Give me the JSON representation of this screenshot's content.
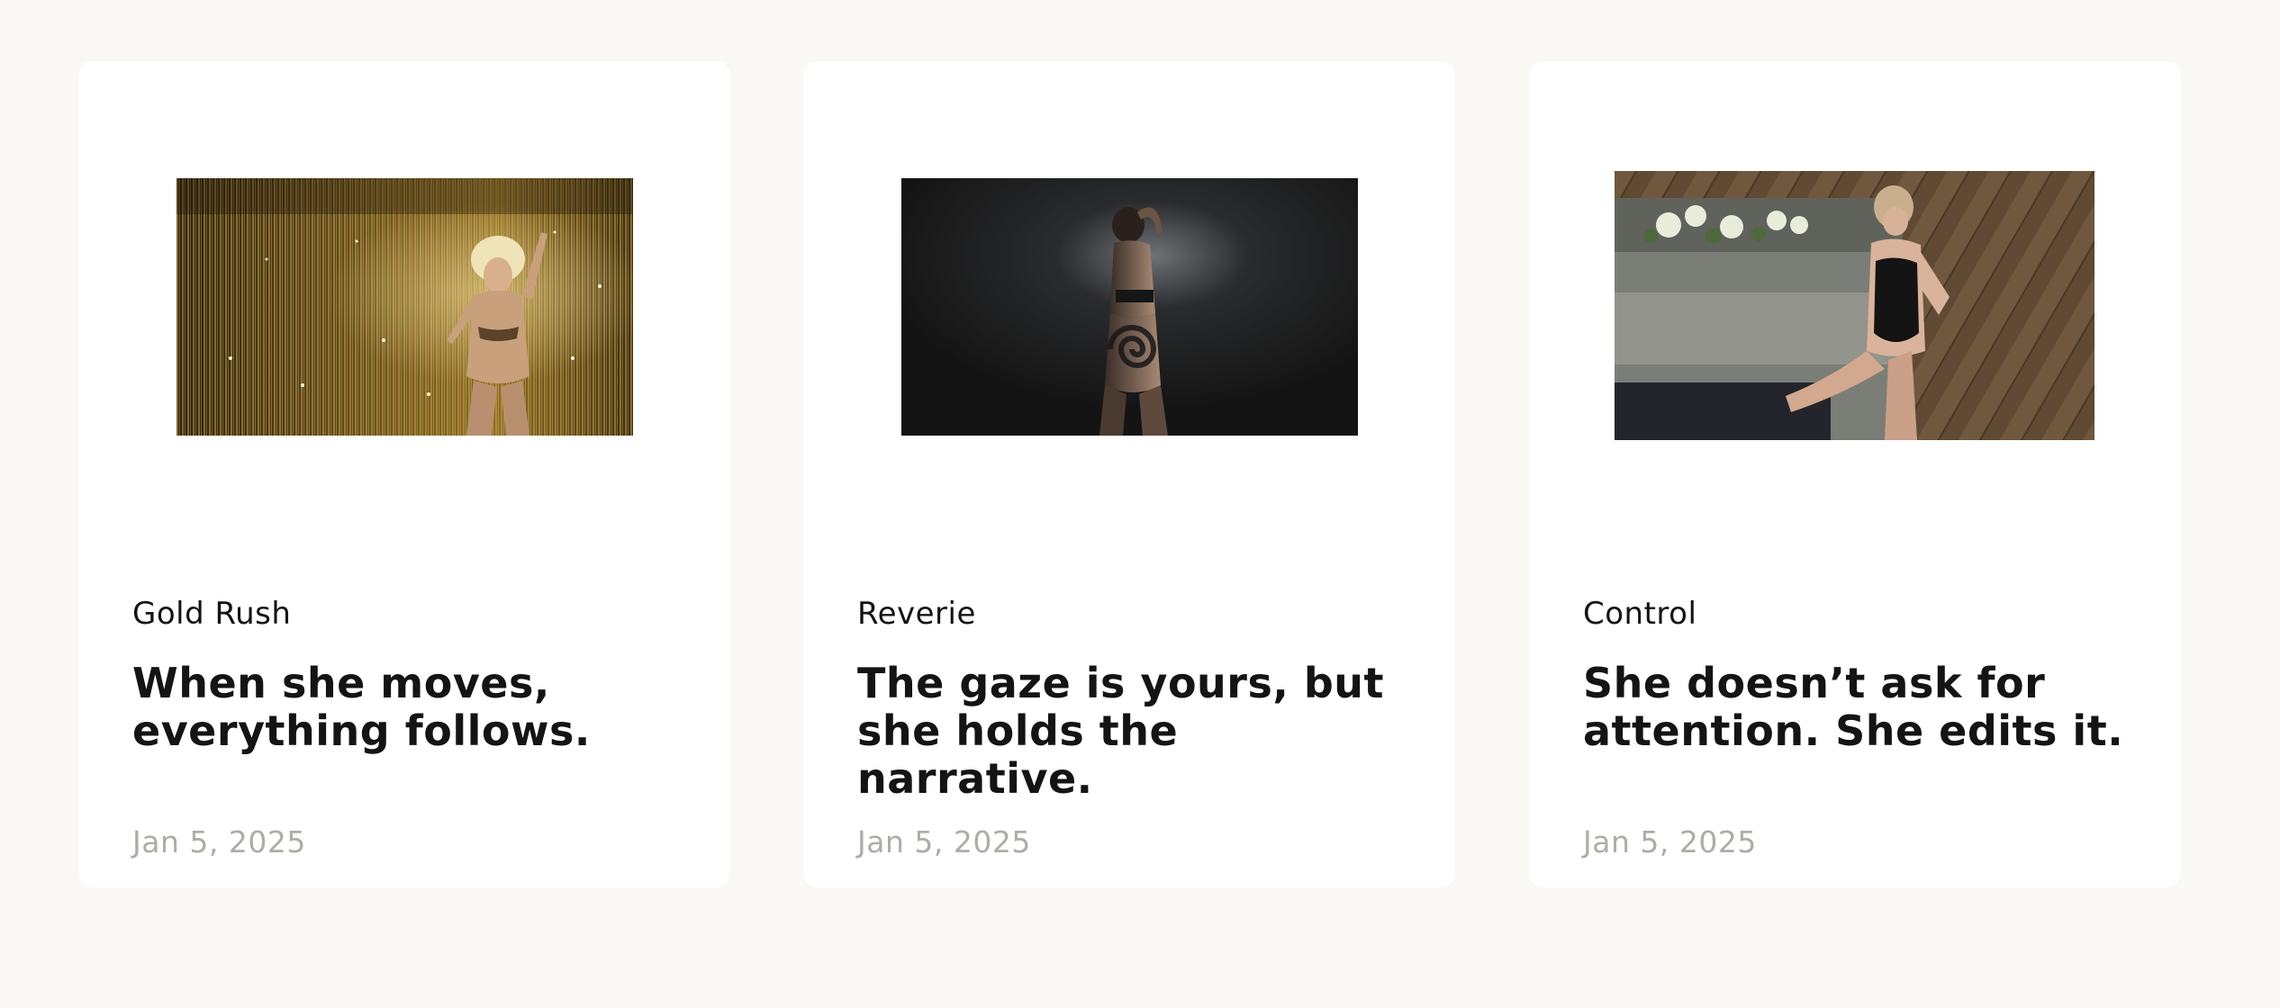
{
  "colors": {
    "page_background": "#f9f8f4",
    "card_background": "#ffffff",
    "text_primary": "#141414",
    "text_muted": "#aeaca6"
  },
  "cards": [
    {
      "category": "Gold Rush",
      "headline": "When she moves, everything follows.",
      "date": "Jan 5, 2025",
      "image_alt": "Woman with a feathered headpiece posing in front of a sparkling gold tinsel curtain"
    },
    {
      "category": "Reverie",
      "headline": "The gaze is yours, but she holds the narrative.",
      "date": "Jan 5, 2025",
      "image_alt": "Woman posing in a dark studio with a spiral light pattern projected on her body"
    },
    {
      "category": "Control",
      "headline": "She doesn’t ask for attention. She edits it.",
      "date": "Jan 5, 2025",
      "image_alt": "Woman in a black bodysuit posing on a grey sofa over a herringbone wood floor"
    }
  ]
}
